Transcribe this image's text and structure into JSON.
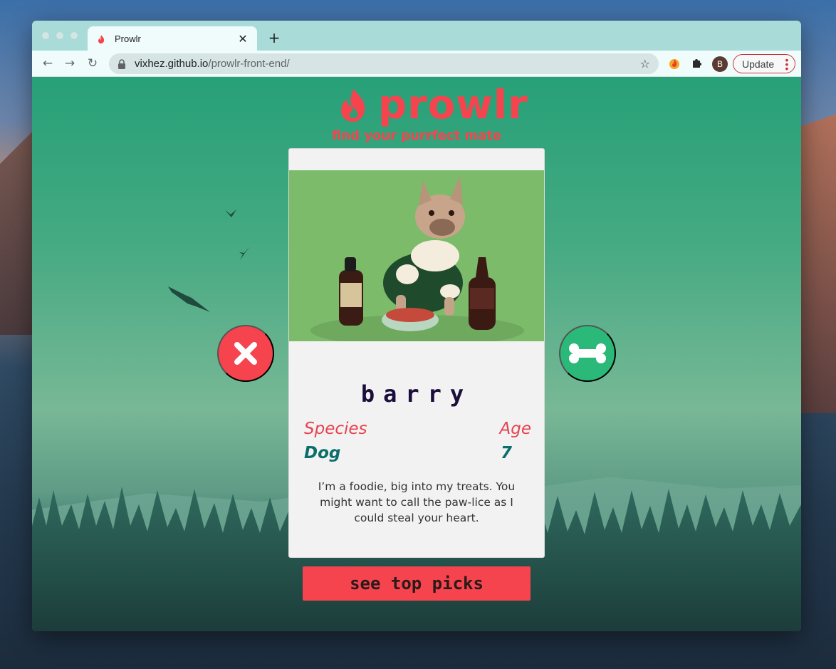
{
  "browser": {
    "tab_title": "Prowlr",
    "url_host": "vixhez.github.io",
    "url_path": "/prowlr-front-end/",
    "profile_initial": "B",
    "update_label": "Update"
  },
  "page": {
    "logo_text": "prowlr",
    "tagline": "find your purrfect mate",
    "profile": {
      "name": "barry",
      "species_label": "Species",
      "age_label": "Age",
      "species": "Dog",
      "age": "7",
      "bio": "I’m a foodie, big into my treats. You might want to call the paw-lice as I could steal your heart."
    },
    "top_picks_label": "see top picks"
  },
  "colors": {
    "brand": "#f5444e",
    "like": "#2bb97a",
    "teal": "#0b6e6a"
  },
  "icons": {
    "reject": "x-icon",
    "like": "bone-icon",
    "logo": "flame-icon"
  }
}
